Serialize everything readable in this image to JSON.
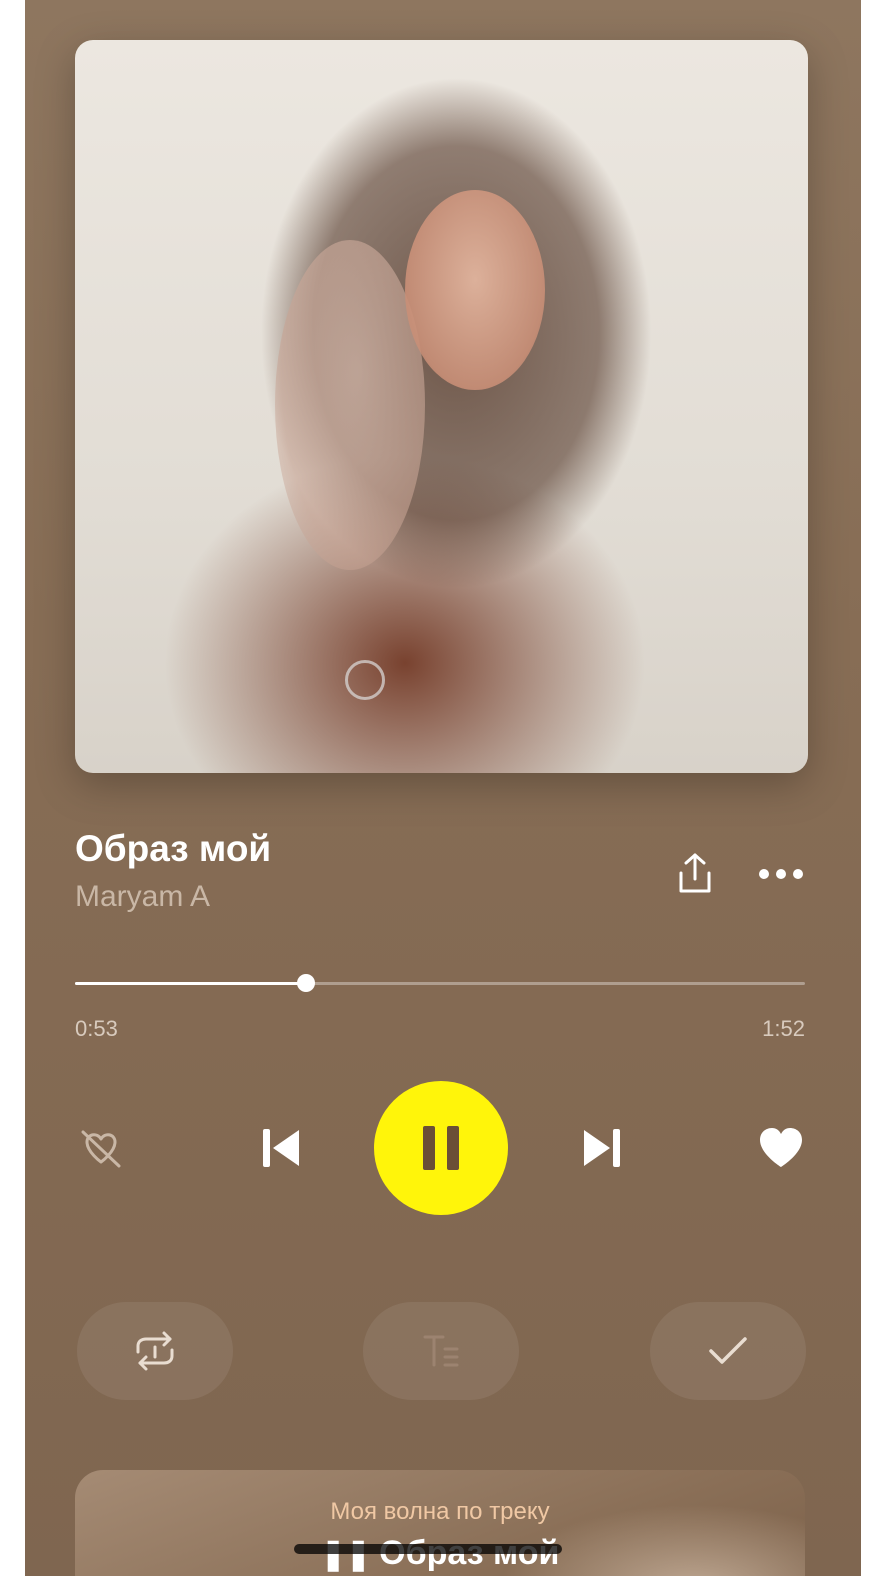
{
  "track": {
    "title": "Образ мой",
    "artist": "Maryam A"
  },
  "progress": {
    "elapsed": "0:53",
    "total": "1:52",
    "fraction": 0.3169
  },
  "controls": {
    "dislike_icon": "dislike-icon",
    "prev_icon": "previous-icon",
    "play_state": "playing",
    "next_icon": "next-icon",
    "like_icon": "heart-icon",
    "play_button_color": "#fff50a"
  },
  "actions": {
    "repeat_icon": "repeat-icon",
    "lyrics_icon": "lyrics-icon",
    "check_icon": "check-icon"
  },
  "wave": {
    "label": "Моя волна по треку",
    "title": "Образ мой"
  },
  "colors": {
    "background": "#876d55",
    "accent": "#fff50a",
    "secondary_text": "#c9b7a6"
  }
}
